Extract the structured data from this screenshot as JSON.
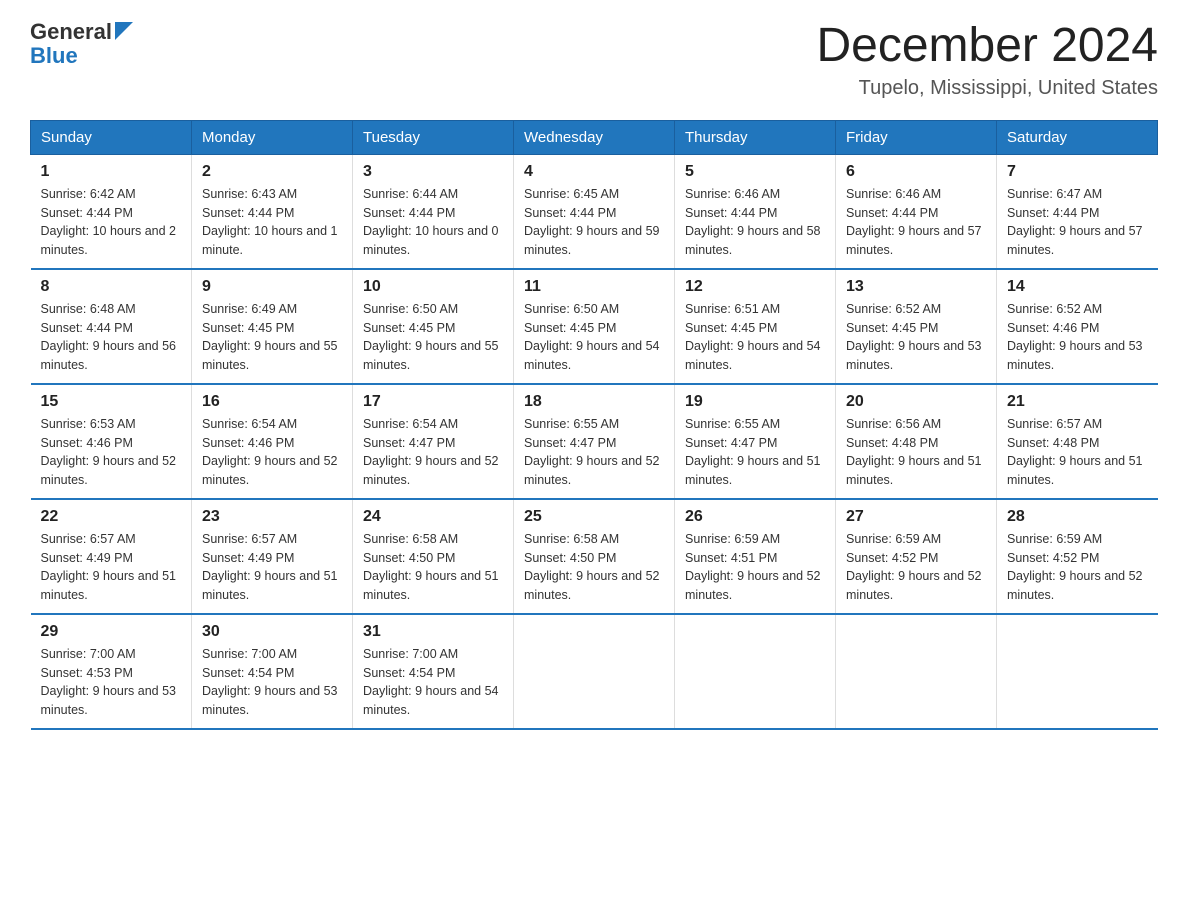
{
  "logo": {
    "general": "General",
    "blue": "Blue"
  },
  "title": {
    "month_year": "December 2024",
    "location": "Tupelo, Mississippi, United States"
  },
  "weekdays": [
    "Sunday",
    "Monday",
    "Tuesday",
    "Wednesday",
    "Thursday",
    "Friday",
    "Saturday"
  ],
  "weeks": [
    [
      {
        "day": "1",
        "sunrise": "6:42 AM",
        "sunset": "4:44 PM",
        "daylight": "10 hours and 2 minutes."
      },
      {
        "day": "2",
        "sunrise": "6:43 AM",
        "sunset": "4:44 PM",
        "daylight": "10 hours and 1 minute."
      },
      {
        "day": "3",
        "sunrise": "6:44 AM",
        "sunset": "4:44 PM",
        "daylight": "10 hours and 0 minutes."
      },
      {
        "day": "4",
        "sunrise": "6:45 AM",
        "sunset": "4:44 PM",
        "daylight": "9 hours and 59 minutes."
      },
      {
        "day": "5",
        "sunrise": "6:46 AM",
        "sunset": "4:44 PM",
        "daylight": "9 hours and 58 minutes."
      },
      {
        "day": "6",
        "sunrise": "6:46 AM",
        "sunset": "4:44 PM",
        "daylight": "9 hours and 57 minutes."
      },
      {
        "day": "7",
        "sunrise": "6:47 AM",
        "sunset": "4:44 PM",
        "daylight": "9 hours and 57 minutes."
      }
    ],
    [
      {
        "day": "8",
        "sunrise": "6:48 AM",
        "sunset": "4:44 PM",
        "daylight": "9 hours and 56 minutes."
      },
      {
        "day": "9",
        "sunrise": "6:49 AM",
        "sunset": "4:45 PM",
        "daylight": "9 hours and 55 minutes."
      },
      {
        "day": "10",
        "sunrise": "6:50 AM",
        "sunset": "4:45 PM",
        "daylight": "9 hours and 55 minutes."
      },
      {
        "day": "11",
        "sunrise": "6:50 AM",
        "sunset": "4:45 PM",
        "daylight": "9 hours and 54 minutes."
      },
      {
        "day": "12",
        "sunrise": "6:51 AM",
        "sunset": "4:45 PM",
        "daylight": "9 hours and 54 minutes."
      },
      {
        "day": "13",
        "sunrise": "6:52 AM",
        "sunset": "4:45 PM",
        "daylight": "9 hours and 53 minutes."
      },
      {
        "day": "14",
        "sunrise": "6:52 AM",
        "sunset": "4:46 PM",
        "daylight": "9 hours and 53 minutes."
      }
    ],
    [
      {
        "day": "15",
        "sunrise": "6:53 AM",
        "sunset": "4:46 PM",
        "daylight": "9 hours and 52 minutes."
      },
      {
        "day": "16",
        "sunrise": "6:54 AM",
        "sunset": "4:46 PM",
        "daylight": "9 hours and 52 minutes."
      },
      {
        "day": "17",
        "sunrise": "6:54 AM",
        "sunset": "4:47 PM",
        "daylight": "9 hours and 52 minutes."
      },
      {
        "day": "18",
        "sunrise": "6:55 AM",
        "sunset": "4:47 PM",
        "daylight": "9 hours and 52 minutes."
      },
      {
        "day": "19",
        "sunrise": "6:55 AM",
        "sunset": "4:47 PM",
        "daylight": "9 hours and 51 minutes."
      },
      {
        "day": "20",
        "sunrise": "6:56 AM",
        "sunset": "4:48 PM",
        "daylight": "9 hours and 51 minutes."
      },
      {
        "day": "21",
        "sunrise": "6:57 AM",
        "sunset": "4:48 PM",
        "daylight": "9 hours and 51 minutes."
      }
    ],
    [
      {
        "day": "22",
        "sunrise": "6:57 AM",
        "sunset": "4:49 PM",
        "daylight": "9 hours and 51 minutes."
      },
      {
        "day": "23",
        "sunrise": "6:57 AM",
        "sunset": "4:49 PM",
        "daylight": "9 hours and 51 minutes."
      },
      {
        "day": "24",
        "sunrise": "6:58 AM",
        "sunset": "4:50 PM",
        "daylight": "9 hours and 51 minutes."
      },
      {
        "day": "25",
        "sunrise": "6:58 AM",
        "sunset": "4:50 PM",
        "daylight": "9 hours and 52 minutes."
      },
      {
        "day": "26",
        "sunrise": "6:59 AM",
        "sunset": "4:51 PM",
        "daylight": "9 hours and 52 minutes."
      },
      {
        "day": "27",
        "sunrise": "6:59 AM",
        "sunset": "4:52 PM",
        "daylight": "9 hours and 52 minutes."
      },
      {
        "day": "28",
        "sunrise": "6:59 AM",
        "sunset": "4:52 PM",
        "daylight": "9 hours and 52 minutes."
      }
    ],
    [
      {
        "day": "29",
        "sunrise": "7:00 AM",
        "sunset": "4:53 PM",
        "daylight": "9 hours and 53 minutes."
      },
      {
        "day": "30",
        "sunrise": "7:00 AM",
        "sunset": "4:54 PM",
        "daylight": "9 hours and 53 minutes."
      },
      {
        "day": "31",
        "sunrise": "7:00 AM",
        "sunset": "4:54 PM",
        "daylight": "9 hours and 54 minutes."
      },
      null,
      null,
      null,
      null
    ]
  ],
  "labels": {
    "sunrise": "Sunrise:",
    "sunset": "Sunset:",
    "daylight": "Daylight:"
  }
}
